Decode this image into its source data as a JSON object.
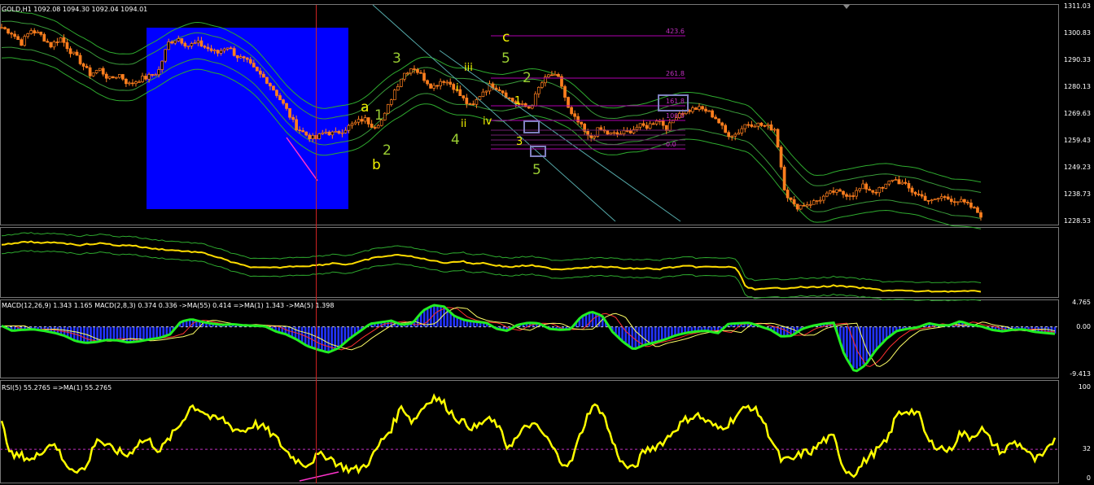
{
  "header": {
    "symbol_label": "GOLD,H1  1092.08 1094.30 1092.04 1094.01"
  },
  "indicators": {
    "macd_label": "MACD(12,26,9) 1.343 1.165  MACD(2,8,3) 0.374 0.336  ->MA(55) 0.414  =>MA(1) 1.343  ->MA(5) 1.398",
    "rsi_label": "RSI(5) 55.2765  =>MA(1) 55.2765"
  },
  "colors": {
    "background": "#000000",
    "candle": "#ff7f1e",
    "envelope": "#2eaa2e",
    "highlight_box": "#0000ff",
    "wave_yellow": "#f2f200",
    "wave_green": "#9acd32",
    "fibo": "#b000b0",
    "macd_main": "#22ee22",
    "macd_hist": "#2233ff",
    "rsi_line": "#ffff00",
    "cursor_line": "#cc2222"
  },
  "chart_data": [
    {
      "type": "candlestick",
      "title": "GOLD,H1",
      "ylim": [
        1228.53,
        1311.03
      ],
      "y_ticks": [
        "1311.03",
        "1300.83",
        "1290.33",
        "1280.13",
        "1269.63",
        "1259.43",
        "1249.23",
        "1238.73",
        "1228.53"
      ],
      "close_path": [
        1303,
        1301,
        1297,
        1302,
        1300,
        1296,
        1299,
        1294,
        1290,
        1285,
        1287,
        1283,
        1285,
        1281,
        1283,
        1284,
        1286,
        1297,
        1299,
        1296,
        1297,
        1295,
        1293,
        1296,
        1292,
        1290,
        1286,
        1283,
        1278,
        1272,
        1265,
        1262,
        1260,
        1263,
        1262,
        1264,
        1266,
        1268,
        1265,
        1268,
        1278,
        1285,
        1288,
        1284,
        1280,
        1283,
        1281,
        1276,
        1272,
        1278,
        1281,
        1279,
        1275,
        1273,
        1272,
        1281,
        1285,
        1283,
        1270,
        1266,
        1260,
        1264,
        1262,
        1262,
        1263,
        1265,
        1265,
        1268,
        1264,
        1270,
        1271,
        1272,
        1271,
        1268,
        1262,
        1262,
        1266,
        1266,
        1265,
        1264,
        1240,
        1234,
        1235,
        1236,
        1238,
        1240,
        1239,
        1239,
        1242,
        1240,
        1241,
        1245,
        1243,
        1240,
        1238,
        1236,
        1238,
        1237,
        1236,
        1234,
        1231
      ],
      "wave_labels": [
        {
          "text": "a",
          "color": "yellow"
        },
        {
          "text": "1",
          "color": "green"
        },
        {
          "text": "b",
          "color": "yellow"
        },
        {
          "text": "2",
          "color": "green"
        },
        {
          "text": "3",
          "color": "green"
        },
        {
          "text": "iii",
          "color": "yellow"
        },
        {
          "text": "i",
          "color": "yellow"
        },
        {
          "text": "ii",
          "color": "yellow"
        },
        {
          "text": "iv",
          "color": "yellow"
        },
        {
          "text": "4",
          "color": "green"
        },
        {
          "text": "c",
          "color": "yellow"
        },
        {
          "text": "5",
          "color": "green"
        },
        {
          "text": "2",
          "color": "green"
        },
        {
          "text": "1",
          "color": "yellow"
        },
        {
          "text": "3",
          "color": "yellow"
        },
        {
          "text": "5",
          "color": "green"
        }
      ],
      "fibo_levels": [
        "423.6",
        "261.8",
        "161.8",
        "100.0",
        "0.0"
      ]
    },
    {
      "type": "line",
      "series": [
        {
          "values": [
            300,
            300,
            298,
            297,
            299,
            298,
            298,
            300,
            301,
            300,
            299,
            300,
            302,
            301,
            303,
            305,
            306,
            307,
            308,
            309,
            310,
            312,
            316,
            320,
            324,
            327,
            329,
            329,
            329,
            328,
            327,
            327,
            326,
            325,
            323,
            325,
            324,
            320,
            317,
            315,
            314,
            313,
            316,
            318,
            320,
            323,
            322,
            321,
            324,
            323,
            325,
            327,
            328,
            327,
            326,
            328,
            330,
            331,
            330,
            329,
            328,
            328,
            328,
            329,
            330,
            330,
            330,
            331,
            329,
            328,
            327,
            328,
            328,
            328,
            328,
            329,
            352,
            356,
            355,
            354,
            354,
            353,
            353,
            353,
            352,
            351,
            352,
            353,
            354,
            355,
            357,
            357,
            357,
            358,
            358,
            358,
            358,
            358,
            358,
            358,
            358
          ]
        }
      ]
    },
    {
      "type": "line",
      "ylim": [
        -9.413,
        4.765
      ],
      "y_ticks": [
        "4.765",
        "0.00",
        "-9.413"
      ],
      "series": [
        {
          "name": "MACD(2,8,3)",
          "values": [
            0.2,
            -0.8,
            -0.6,
            -0.5,
            -0.8,
            -1.2,
            -1.8,
            -2.8,
            -3.2,
            -3.0,
            -2.6,
            -2.7,
            -3.1,
            -2.9,
            -2.5,
            -2.2,
            -1.5,
            1.0,
            1.5,
            1.0,
            0.6,
            0.4,
            0.5,
            0.3,
            0.2,
            0.1,
            -0.9,
            -1.5,
            -2.5,
            -3.8,
            -4.5,
            -5.1,
            -4.2,
            -2.4,
            -0.9,
            0.6,
            0.9,
            1.2,
            0.4,
            0.7,
            3.2,
            4.3,
            4.0,
            2.1,
            1.3,
            1.0,
            0.8,
            -0.4,
            -0.8,
            0.4,
            0.8,
            0.7,
            -0.4,
            -0.6,
            -0.5,
            2.0,
            3.0,
            2.2,
            -1.0,
            -3.0,
            -4.5,
            -3.6,
            -3.1,
            -2.5,
            -1.7,
            -1.2,
            -0.9,
            -0.8,
            -1.3,
            0.6,
            0.7,
            0.8,
            0.1,
            -0.6,
            -1.9,
            -1.8,
            -0.4,
            0.2,
            0.6,
            0.8,
            -5.5,
            -9.0,
            -7.6,
            -4.6,
            -2.4,
            -0.8,
            -0.4,
            -0.1,
            0.7,
            0.3,
            0.3,
            1.1,
            0.4,
            0.1,
            -0.6,
            -0.9,
            -0.6,
            -0.5,
            -1.0,
            -1.2,
            -1.4
          ]
        }
      ]
    },
    {
      "type": "line",
      "ylim": [
        0,
        100
      ],
      "y_ticks": [
        "100",
        "32",
        "0"
      ],
      "series": [
        {
          "name": "RSI(5)",
          "values": [
            60,
            24,
            25,
            20,
            33,
            40,
            15,
            10,
            10,
            45,
            35,
            30,
            25,
            40,
            42,
            30,
            45,
            60,
            80,
            75,
            65,
            65,
            55,
            52,
            60,
            55,
            45,
            30,
            20,
            15,
            25,
            25,
            15,
            10,
            10,
            20,
            40,
            55,
            80,
            62,
            78,
            90,
            82,
            68,
            60,
            55,
            65,
            60,
            35,
            45,
            60,
            55,
            40,
            20,
            15,
            50,
            80,
            75,
            40,
            15,
            10,
            30,
            35,
            42,
            55,
            65,
            70,
            62,
            55,
            60,
            72,
            80,
            70,
            45,
            20,
            20,
            28,
            30,
            42,
            45,
            10,
            5,
            20,
            30,
            40,
            70,
            75,
            72,
            40,
            35,
            30,
            50,
            45,
            55,
            40,
            28,
            40,
            35,
            20,
            25,
            45
          ]
        }
      ]
    }
  ]
}
